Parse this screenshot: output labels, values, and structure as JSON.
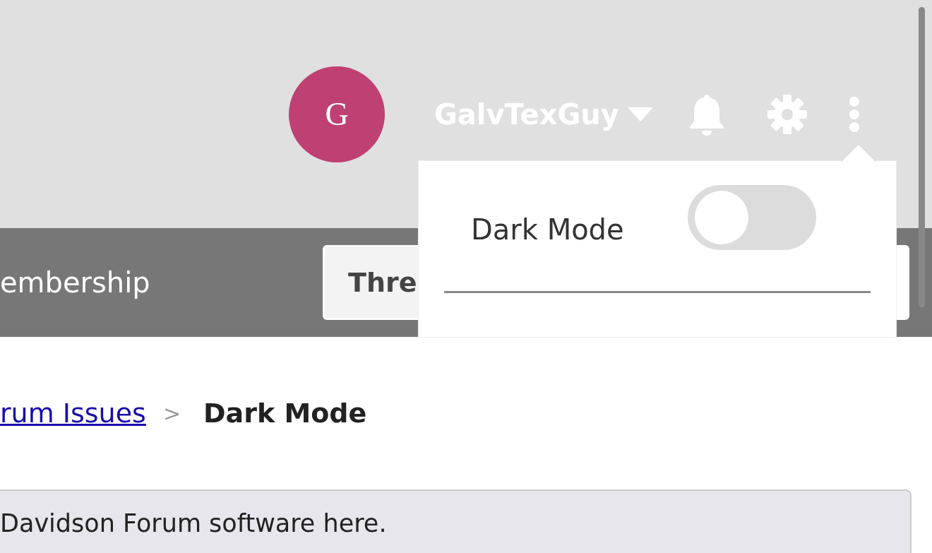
{
  "header": {
    "avatar_letter": "G",
    "username": "GalvTexGuy"
  },
  "nav": {
    "item": "embership",
    "search_scope": "Thre"
  },
  "dropdown": {
    "items": [
      {
        "kind": "toggle",
        "label": "Dark Mode",
        "on": false
      }
    ]
  },
  "breadcrumb": {
    "link": "rum Issues",
    "separator": ">",
    "current": "Dark Mode"
  },
  "notice": {
    "text": "Davidson Forum software here."
  }
}
